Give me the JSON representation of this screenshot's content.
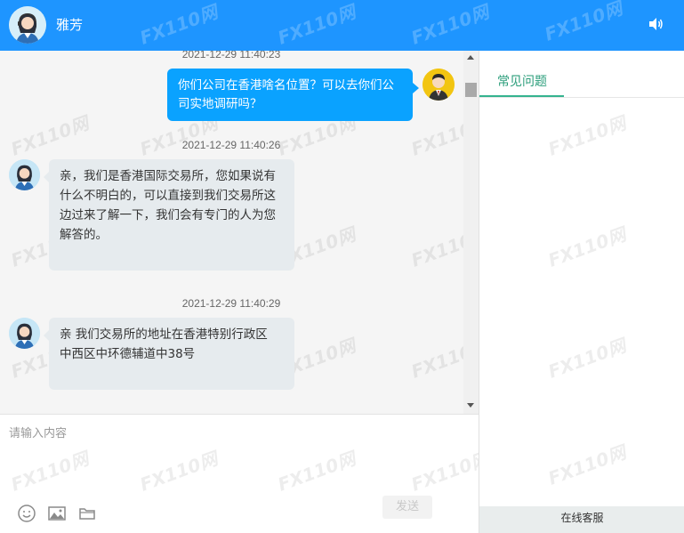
{
  "header": {
    "agent_name": "雅芳",
    "bg_color": "#1e95ff"
  },
  "messages": [
    {
      "timestamp": "2021-12-29 11:40:23",
      "sender": "user",
      "lines": [
        "你们公司在香港啥名位置？可以去你们公",
        "司实地调研吗？"
      ]
    },
    {
      "timestamp": "2021-12-29 11:40:26",
      "sender": "agent",
      "lines": [
        "亲，我们是香港国际交易所，您如果说有",
        "什么不明白的，可以直接到我们交易所这",
        "边过来了解一下，我们会有专门的人为您",
        "解答的。"
      ]
    },
    {
      "timestamp": "2021-12-29 11:40:29",
      "sender": "agent",
      "lines": [
        "亲 我们交易所的地址在香港特别行政区",
        "中西区中环德辅道中38号"
      ]
    }
  ],
  "input": {
    "placeholder": "请输入内容",
    "send_label": "发送"
  },
  "toolbar_icons": [
    "emoji-icon",
    "image-icon",
    "folder-icon"
  ],
  "right_panel": {
    "tab_label": "常见问题",
    "footer_label": "在线客服",
    "accent_color": "#35b38f"
  },
  "watermark": {
    "text": "110网"
  }
}
